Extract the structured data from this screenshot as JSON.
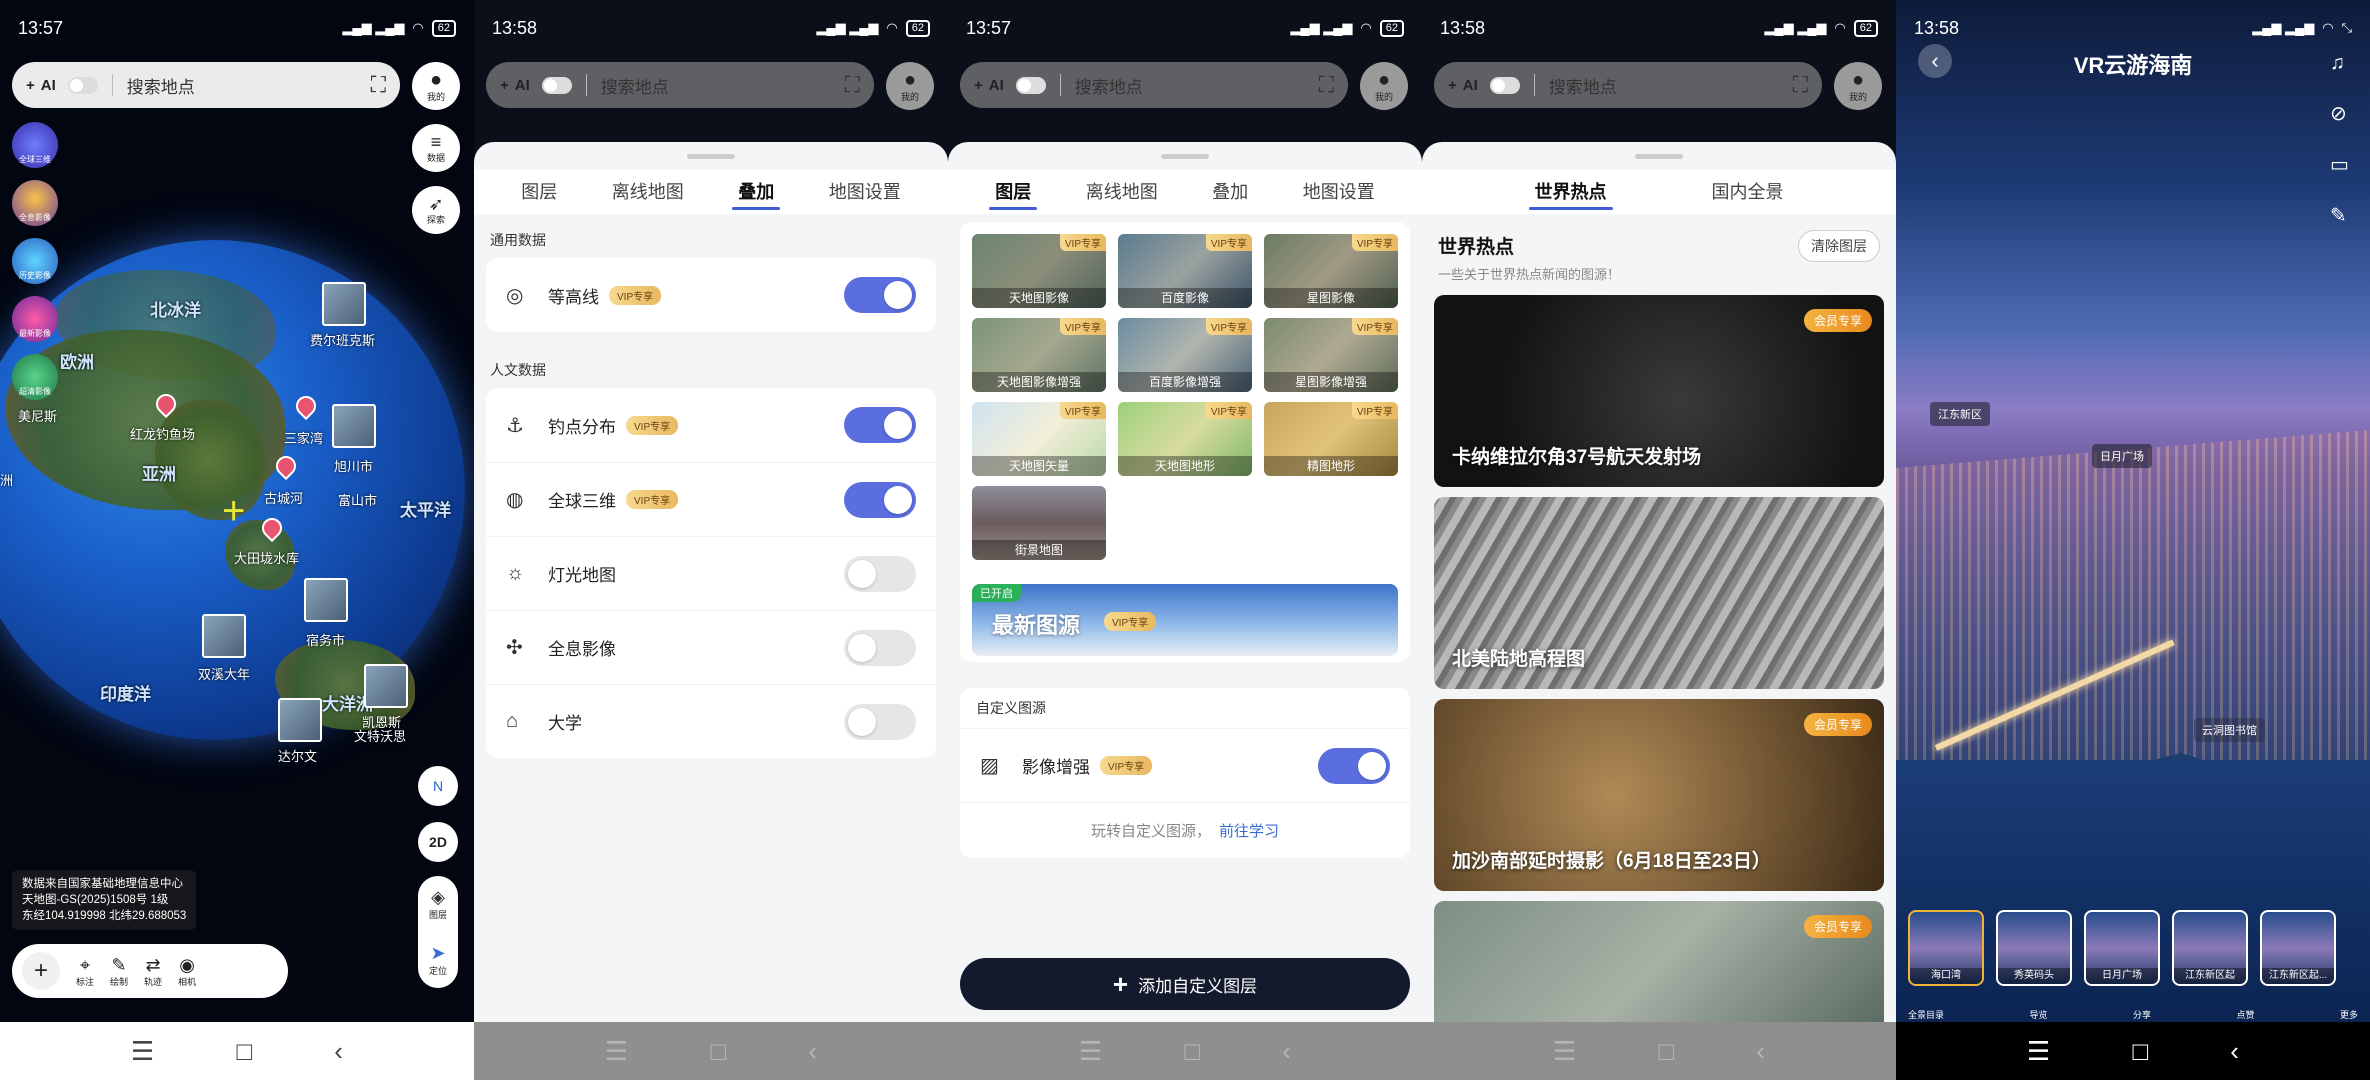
{
  "status": {
    "s1_time": "13:57",
    "s2_time": "13:58",
    "s3_time": "13:57",
    "s4_time": "13:58",
    "s5_time": "13:58",
    "battery": "62"
  },
  "topbar": {
    "ai_label": "AI",
    "search_placeholder": "搜索地点",
    "me_label": "我的"
  },
  "map": {
    "left_tools": [
      "全球三维",
      "全息影像",
      "历史影像",
      "最新影像",
      "超清影像"
    ],
    "right_tools": [
      "数据",
      "探索"
    ],
    "labels": [
      {
        "text": "北冰洋",
        "big": true
      },
      {
        "text": "欧洲",
        "big": true
      },
      {
        "text": "亚洲",
        "big": true
      },
      {
        "text": "太平洋",
        "big": true
      },
      {
        "text": "印度洋",
        "big": true
      },
      {
        "text": "大洋洲",
        "big": true
      },
      {
        "text": "费尔班克斯"
      },
      {
        "text": "红龙钓鱼场"
      },
      {
        "text": "三家湾"
      },
      {
        "text": "旭川市"
      },
      {
        "text": "古城河"
      },
      {
        "text": "富山市"
      },
      {
        "text": "大田垅水库"
      },
      {
        "text": "宿务市"
      },
      {
        "text": "双溪大年"
      },
      {
        "text": "凯恩斯"
      },
      {
        "text": "文特沃思"
      },
      {
        "text": "达尔文"
      },
      {
        "text": "美尼斯"
      },
      {
        "text": "洲"
      }
    ],
    "compass": "N",
    "mode_2d": "2D",
    "layers_label": "图层",
    "locate_label": "定位",
    "info_lines": [
      "数据来自国家基础地理信息中心",
      "天地图-GS(2025)1508号    1级",
      "东经104.919998  北纬29.688053"
    ],
    "bottom_tools": [
      "标注",
      "绘制",
      "轨迹",
      "相机"
    ]
  },
  "overlay": {
    "tabs": [
      "图层",
      "离线地图",
      "叠加",
      "地图设置"
    ],
    "active_tab": "叠加",
    "vip_label": "VIP专享",
    "general_title": "通用数据",
    "general_rows": [
      {
        "label": "等高线",
        "vip": true,
        "on": true
      }
    ],
    "human_title": "人文数据",
    "human_rows": [
      {
        "label": "钓点分布",
        "vip": true,
        "on": true
      },
      {
        "label": "全球三维",
        "vip": true,
        "on": true
      },
      {
        "label": "灯光地图",
        "vip": false,
        "on": false
      },
      {
        "label": "全息影像",
        "vip": false,
        "on": false
      },
      {
        "label": "大学",
        "vip": false,
        "on": false
      }
    ]
  },
  "layers": {
    "tiles": [
      "天地图影像",
      "百度影像",
      "星图影像",
      "天地图影像增强",
      "百度影像增强",
      "星图影像增强",
      "天地图矢量",
      "天地图地形",
      "精图地形",
      "街景地图"
    ],
    "banner_tag": "已开启",
    "banner_title": "最新图源",
    "custom_title": "自定义图源",
    "custom_row": "影像增强",
    "learn_text": "玩转自定义图源，",
    "learn_link": "前往学习",
    "add_button": "添加自定义图层"
  },
  "hot": {
    "tabs": [
      "世界热点",
      "国内全景"
    ],
    "title": "世界热点",
    "subtitle": "一些关于世界热点新闻的图源！",
    "clear_button": "清除图层",
    "member_tag": "会员专享",
    "cards": [
      {
        "title": "卡纳维拉尔角37号航天发射场",
        "member": true
      },
      {
        "title": "北美陆地高程图",
        "member": false
      },
      {
        "title": "加沙南部延时摄影（6月18日至23日）",
        "member": true
      },
      {
        "title": "",
        "member": true
      }
    ]
  },
  "vr": {
    "title": "VR云游海南",
    "tags": [
      "江东新区",
      "日月广场",
      "云洞图书馆"
    ],
    "thumbs": [
      "海口湾",
      "秀英码头",
      "日月广场",
      "江东新区起",
      "江东新区起..."
    ],
    "bottom_labels": [
      "全景目录",
      "导览",
      "分享",
      "点赞",
      "更多"
    ]
  }
}
